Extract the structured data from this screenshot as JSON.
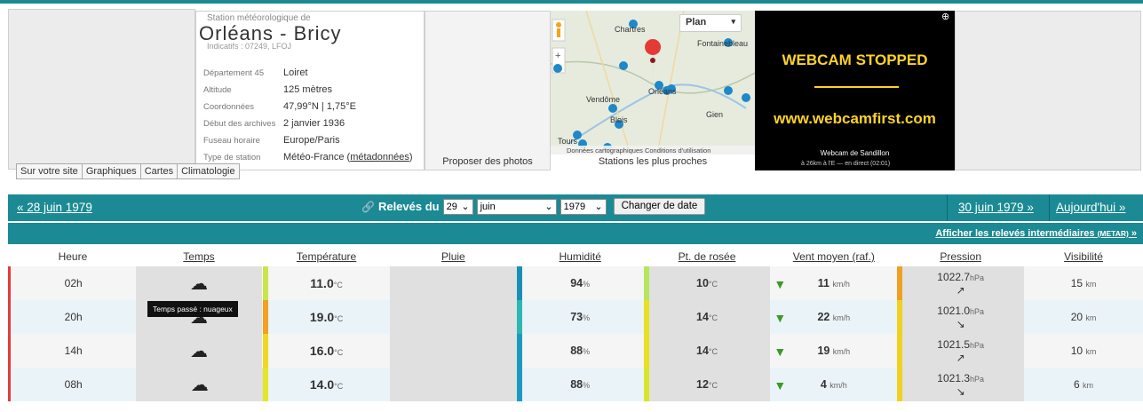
{
  "station": {
    "kicker": "Station météorologique de",
    "name": "Orléans - Bricy",
    "codes": "Indicatifs : 07249, LFOJ",
    "info": [
      {
        "key": "Département 45",
        "value": "Loiret"
      },
      {
        "key": "Altitude",
        "value": "125 mètres"
      },
      {
        "key": "Coordonnées",
        "value": "47,99°N | 1,75°E"
      },
      {
        "key": "Début des archives",
        "value": "2 janvier 1936"
      },
      {
        "key": "Fuseau horaire",
        "value": "Europe/Paris"
      },
      {
        "key": "Type de station",
        "value": "Météo-France (",
        "link": "métadonnées",
        "tail": ")"
      }
    ]
  },
  "tabs": [
    "Sur votre site",
    "Graphiques",
    "Cartes",
    "Climatologie"
  ],
  "photos_link": "Proposer des photos",
  "map": {
    "plan_label": "Plan",
    "footer": "Stations les plus proches",
    "credits": "Données cartographiques   Conditions d'utilisation",
    "towns": [
      "Chartres",
      "Fontainebleau",
      "Orléans",
      "Vendôme",
      "Blois",
      "Gien",
      "Tours"
    ]
  },
  "webcam": {
    "line1": "WEBCAM STOPPED",
    "line2": "www.webcamfirst.com",
    "caption": "Webcam de Sandillon",
    "subcaption": "à 26km à l'E — en direct (02:01)"
  },
  "nav": {
    "prev": "« 28 juin 1979",
    "title": "Relevés du",
    "day": "29",
    "month": "juin",
    "year": "1979",
    "button": "Changer de date",
    "next": "30 juin 1979 »",
    "today": "Aujourd'hui »"
  },
  "intermediate": {
    "text": "Afficher les relevés intermédiaires ",
    "small": "(METAR)",
    "tail": " »"
  },
  "columns": [
    "Heure",
    "Temps",
    "Température",
    "Pluie",
    "Humidité",
    "Pt. de rosée",
    "Vent moyen (raf.)",
    "Pression",
    "Visibilité"
  ],
  "tooltip": "Temps passé : nuageux",
  "units": {
    "temp": "°C",
    "wind": "km/h",
    "press": "hPa",
    "vis": "km"
  },
  "rows": [
    {
      "hour": "02h",
      "temp": "11.0",
      "hum": "94",
      "dew": "10",
      "wind": "11",
      "press": "1022.7",
      "parrow": "↗",
      "vis": "15",
      "tcol": "#c8e64a",
      "hcol": "#1a8fb5",
      "dcol": "#b6e65a",
      "pcol": "#f0a020"
    },
    {
      "hour": "20h",
      "temp": "19.0",
      "hum": "73",
      "dew": "14",
      "wind": "22",
      "press": "1021.0",
      "parrow": "↘",
      "vis": "20",
      "tcol": "#f4a020",
      "hcol": "#2ab8b0",
      "dcol": "#e8e020",
      "pcol": "#f0d020"
    },
    {
      "hour": "14h",
      "temp": "16.0",
      "hum": "88",
      "dew": "14",
      "wind": "19",
      "press": "1021.5",
      "parrow": "↗",
      "vis": "10",
      "tcol": "#f0d820",
      "hcol": "#1a9ac0",
      "dcol": "#e8e020",
      "pcol": "#f0d020"
    },
    {
      "hour": "08h",
      "temp": "14.0",
      "hum": "88",
      "dew": "12",
      "wind": "4",
      "press": "1021.3",
      "parrow": "↘",
      "vis": "6",
      "tcol": "#e4e62a",
      "hcol": "#1a9ac0",
      "dcol": "#d8e628",
      "pcol": "#f0d020"
    }
  ]
}
